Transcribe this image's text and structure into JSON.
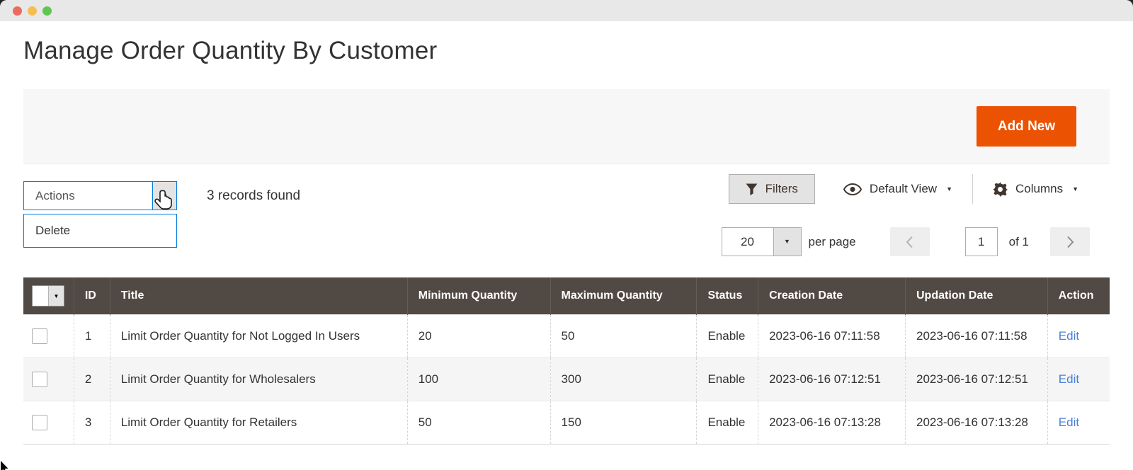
{
  "page": {
    "title": "Manage Order Quantity By Customer"
  },
  "toolbar": {
    "add_new_label": "Add New"
  },
  "grid_controls": {
    "actions": {
      "label": "Actions",
      "menu_items": [
        "Delete"
      ]
    },
    "records_found": "3 records found",
    "filters_label": "Filters",
    "view_label": "Default View",
    "columns_label": "Columns"
  },
  "pagination": {
    "page_size": "20",
    "per_page_label": "per page",
    "current_page": "1",
    "total_label": "of 1"
  },
  "table": {
    "columns": [
      "ID",
      "Title",
      "Minimum Quantity",
      "Maximum Quantity",
      "Status",
      "Creation Date",
      "Updation Date",
      "Action"
    ],
    "rows": [
      {
        "id": "1",
        "title": "Limit Order Quantity for Not Logged In Users",
        "min_qty": "20",
        "max_qty": "50",
        "status": "Enable",
        "created": "2023-06-16 07:11:58",
        "updated": "2023-06-16 07:11:58",
        "action": "Edit"
      },
      {
        "id": "2",
        "title": "Limit Order Quantity for Wholesalers",
        "min_qty": "100",
        "max_qty": "300",
        "status": "Enable",
        "created": "2023-06-16 07:12:51",
        "updated": "2023-06-16 07:12:51",
        "action": "Edit"
      },
      {
        "id": "3",
        "title": "Limit Order Quantity for Retailers",
        "min_qty": "50",
        "max_qty": "150",
        "status": "Enable",
        "created": "2023-06-16 07:13:28",
        "updated": "2023-06-16 07:13:28",
        "action": "Edit"
      }
    ]
  },
  "icons": {
    "caret_down": "▼",
    "filter": "funnel-icon",
    "eye": "eye-icon",
    "gear": "gear-icon"
  },
  "colors": {
    "accent_orange": "#EB5202",
    "grid_header_bg": "#514943",
    "focus_border_blue": "#007BDB",
    "link_blue": "#4A80D9",
    "row_stripe": "#F5F5F5",
    "band_bg": "#F7F7F7",
    "control_gray": "#E3E3E3"
  }
}
